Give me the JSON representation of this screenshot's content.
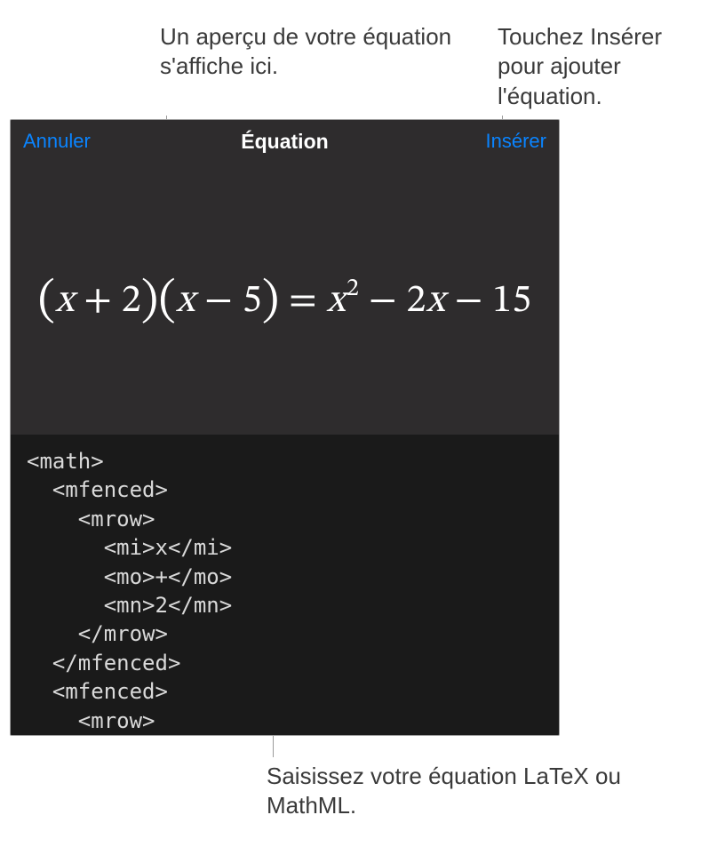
{
  "callouts": {
    "preview": "Un aperçu de votre équation s'affiche ici.",
    "insert": "Touchez Insérer pour ajouter l'équation.",
    "input": "Saisissez votre équation LaTeX ou MathML."
  },
  "toolbar": {
    "cancel": "Annuler",
    "title": "Équation",
    "insert": "Insérer"
  },
  "equation": {
    "display_html": "<span class=\"paren\">(</span>x <span class=\"rm\">+ 2</span><span class=\"paren\">)</span><span class=\"paren\">(</span>x <span class=\"rm\">− 5</span><span class=\"paren\">)</span> <span class=\"rm\">=</span> x<sup>2</sup> <span class=\"rm\">− 2</span>x <span class=\"rm\">− 15</span>"
  },
  "code": {
    "lines": [
      "<math>",
      "  <mfenced>",
      "    <mrow>",
      "      <mi>x</mi>",
      "      <mo>+</mo>",
      "      <mn>2</mn>",
      "    </mrow>",
      "  </mfenced>",
      "  <mfenced>",
      "    <mrow>"
    ]
  }
}
